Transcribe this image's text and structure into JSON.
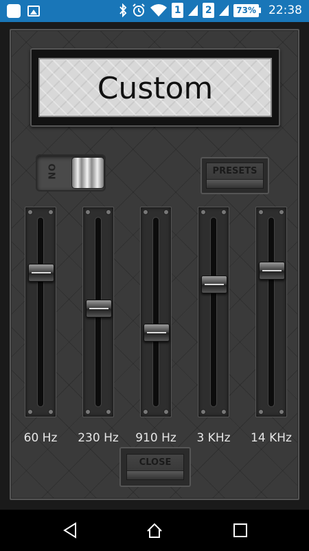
{
  "status_bar": {
    "sim1": "1",
    "sim2": "2",
    "battery": "73%",
    "time": "22:38"
  },
  "display": {
    "preset_name": "Custom"
  },
  "toggle": {
    "label": "ON",
    "state": "on"
  },
  "buttons": {
    "presets": "PRESETS",
    "close": "CLOSE"
  },
  "equalizer": {
    "bands": [
      {
        "label": "60 Hz",
        "level": 0.73
      },
      {
        "label": "230 Hz",
        "level": 0.52
      },
      {
        "label": "910 Hz",
        "level": 0.38
      },
      {
        "label": "3 KHz",
        "level": 0.66
      },
      {
        "label": "14 KHz",
        "level": 0.74
      }
    ]
  },
  "colors": {
    "status_bar": "#1976b8",
    "panel": "#3a3a3a",
    "nav_bar": "#000000"
  },
  "icons": {
    "status_left": [
      "notification-square-icon",
      "image-icon"
    ],
    "status_right": [
      "bluetooth-icon",
      "alarm-icon",
      "wifi-icon",
      "signal-icon",
      "battery-icon"
    ],
    "nav": [
      "back-icon",
      "home-icon",
      "recent-apps-icon"
    ]
  }
}
